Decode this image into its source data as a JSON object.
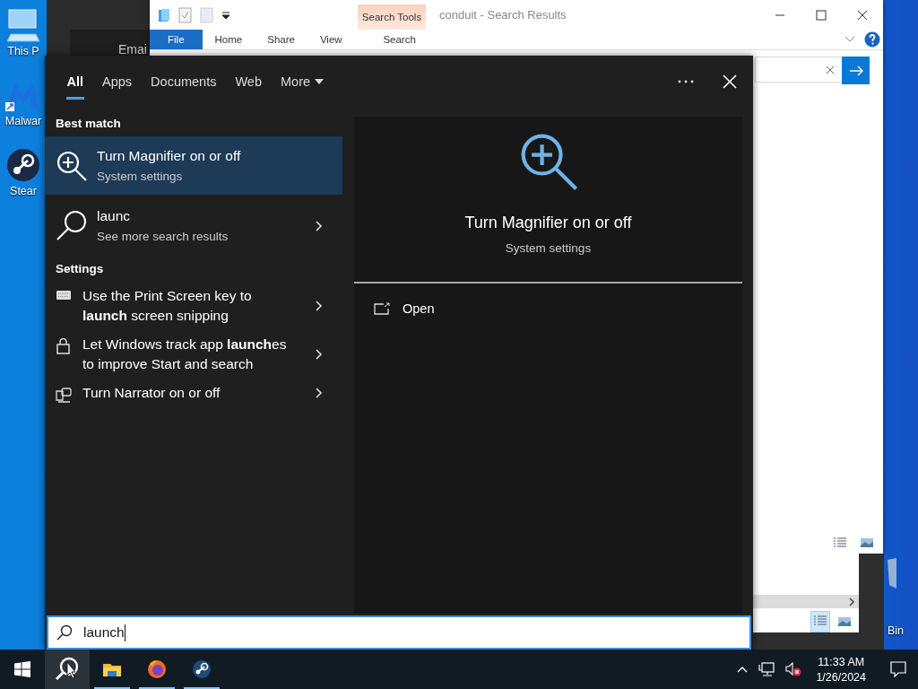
{
  "desktop_icons": [
    {
      "label": "This P"
    },
    {
      "label": "Malwar"
    },
    {
      "label": "Stear"
    }
  ],
  "recycle_bin": {
    "label": "Bin"
  },
  "background_window": {
    "label": "Emai"
  },
  "explorer": {
    "title": "conduit - Search Results",
    "context_tab": "Search Tools",
    "ribbon_tabs": [
      {
        "label": "File",
        "selected": true
      },
      {
        "label": "Home",
        "selected": false
      },
      {
        "label": "Share",
        "selected": false
      },
      {
        "label": "View",
        "selected": false
      },
      {
        "label": "Search",
        "selected": false
      }
    ]
  },
  "search_panel": {
    "filters": [
      {
        "label": "All",
        "selected": true,
        "kind": "plain"
      },
      {
        "label": "Apps",
        "selected": false,
        "kind": "plain"
      },
      {
        "label": "Documents",
        "selected": false,
        "kind": "plain"
      },
      {
        "label": "Web",
        "selected": false,
        "kind": "plain"
      },
      {
        "label": "More",
        "selected": false,
        "kind": "menu"
      }
    ],
    "sections": [
      {
        "heading": "Best match",
        "items": [
          {
            "kind": "app",
            "title": "Turn Magnifier on or off",
            "subtitle": "System settings",
            "selected": true
          }
        ]
      },
      {
        "items": [
          {
            "kind": "web",
            "title": "launc",
            "subtitle": "See more search results",
            "selected": false
          }
        ]
      },
      {
        "heading": "Settings",
        "items": [
          {
            "kind": "setting",
            "title": "Use the Print Screen key to **launch** screen snipping",
            "selected": false
          },
          {
            "kind": "setting",
            "title": "Let Windows track app **launch**es to improve Start and search",
            "selected": false
          },
          {
            "kind": "setting",
            "title": "Turn Narrator on or off",
            "selected": false
          }
        ]
      }
    ],
    "preview": {
      "title": "Turn Magnifier on or off",
      "subtitle": "System settings",
      "actions": [
        {
          "label": "Open"
        }
      ]
    },
    "search_box": {
      "value": "launch"
    }
  },
  "taskbar": {
    "apps": [
      {
        "running": true
      },
      {
        "running": true
      },
      {
        "running": true
      }
    ],
    "time": "11:33 AM",
    "date": "1/26/2024"
  }
}
